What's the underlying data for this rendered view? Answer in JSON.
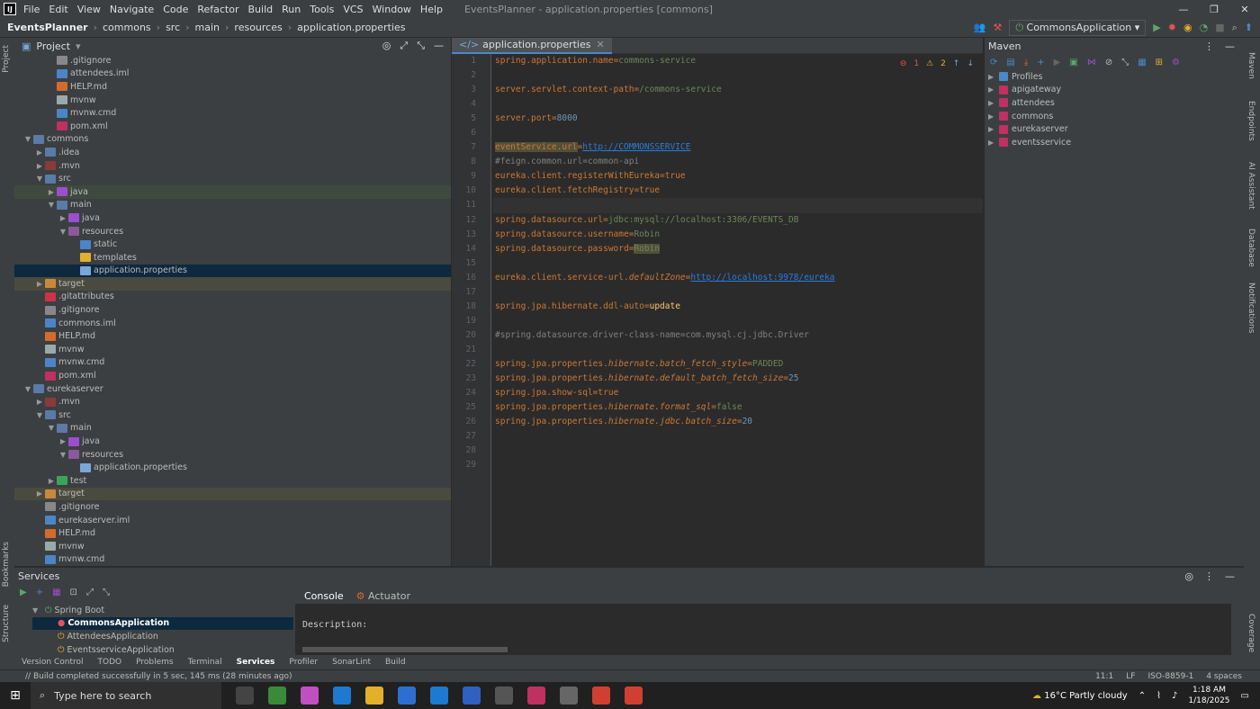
{
  "titlebar": {
    "menu": [
      "File",
      "Edit",
      "View",
      "Navigate",
      "Code",
      "Refactor",
      "Build",
      "Run",
      "Tools",
      "VCS",
      "Window",
      "Help"
    ],
    "title": "EventsPlanner - application.properties [commons]"
  },
  "navbar": {
    "crumbs": [
      "EventsPlanner",
      "commons",
      "src",
      "main",
      "resources",
      "application.properties"
    ],
    "run_config": "CommonsApplication"
  },
  "project": {
    "label": "Project",
    "rows": [
      {
        "d": 3,
        "a": "",
        "t": ".gitignore",
        "c": "#888",
        "s": ""
      },
      {
        "d": 3,
        "a": "",
        "t": "attendees.iml",
        "c": "#4a86c7",
        "s": ""
      },
      {
        "d": 3,
        "a": "",
        "t": "HELP.md",
        "c": "#d46b2d",
        "s": ""
      },
      {
        "d": 3,
        "a": "",
        "t": "mvnw",
        "c": "#9aa",
        "s": ""
      },
      {
        "d": 3,
        "a": "",
        "t": "mvnw.cmd",
        "c": "#4a86c7",
        "s": ""
      },
      {
        "d": 3,
        "a": "",
        "t": "pom.xml",
        "c": "#c03060",
        "s": ""
      },
      {
        "d": 1,
        "a": "▼",
        "t": "commons",
        "c": "#5a7ba8",
        "s": ""
      },
      {
        "d": 2,
        "a": "▶",
        "t": ".idea",
        "c": "#5a7ba8",
        "s": ""
      },
      {
        "d": 2,
        "a": "▶",
        "t": ".mvn",
        "c": "#8b3a3a",
        "s": ""
      },
      {
        "d": 2,
        "a": "▼",
        "t": "src",
        "c": "#5a7ba8",
        "s": ""
      },
      {
        "d": 3,
        "a": "▶",
        "t": "java",
        "c": "#9d4ed0",
        "s": "gr"
      },
      {
        "d": 3,
        "a": "▼",
        "t": "main",
        "c": "#5a7ba8",
        "s": ""
      },
      {
        "d": 4,
        "a": "▶",
        "t": "java",
        "c": "#9d4ed0",
        "s": ""
      },
      {
        "d": 4,
        "a": "▼",
        "t": "resources",
        "c": "#8a5a9a",
        "s": ""
      },
      {
        "d": 5,
        "a": "",
        "t": "static",
        "c": "#4a86c7",
        "s": ""
      },
      {
        "d": 5,
        "a": "",
        "t": "templates",
        "c": "#e2b02c",
        "s": ""
      },
      {
        "d": 5,
        "a": "",
        "t": "application.properties",
        "c": "#7aa7d9",
        "s": "sel"
      },
      {
        "d": 2,
        "a": "▶",
        "t": "target",
        "c": "#c88a3a",
        "s": "hl"
      },
      {
        "d": 2,
        "a": "",
        "t": ".gitattributes",
        "c": "#c34",
        "s": ""
      },
      {
        "d": 2,
        "a": "",
        "t": ".gitignore",
        "c": "#888",
        "s": ""
      },
      {
        "d": 2,
        "a": "",
        "t": "commons.iml",
        "c": "#4a86c7",
        "s": ""
      },
      {
        "d": 2,
        "a": "",
        "t": "HELP.md",
        "c": "#d46b2d",
        "s": ""
      },
      {
        "d": 2,
        "a": "",
        "t": "mvnw",
        "c": "#9aa",
        "s": ""
      },
      {
        "d": 2,
        "a": "",
        "t": "mvnw.cmd",
        "c": "#4a86c7",
        "s": ""
      },
      {
        "d": 2,
        "a": "",
        "t": "pom.xml",
        "c": "#c03060",
        "s": ""
      },
      {
        "d": 1,
        "a": "▼",
        "t": "eurekaserver",
        "c": "#5a7ba8",
        "s": ""
      },
      {
        "d": 2,
        "a": "▶",
        "t": ".mvn",
        "c": "#8b3a3a",
        "s": ""
      },
      {
        "d": 2,
        "a": "▼",
        "t": "src",
        "c": "#5a7ba8",
        "s": ""
      },
      {
        "d": 3,
        "a": "▼",
        "t": "main",
        "c": "#5a7ba8",
        "s": ""
      },
      {
        "d": 4,
        "a": "▶",
        "t": "java",
        "c": "#9d4ed0",
        "s": ""
      },
      {
        "d": 4,
        "a": "▼",
        "t": "resources",
        "c": "#8a5a9a",
        "s": ""
      },
      {
        "d": 5,
        "a": "",
        "t": "application.properties",
        "c": "#7aa7d9",
        "s": ""
      },
      {
        "d": 3,
        "a": "▶",
        "t": "test",
        "c": "#3aa55a",
        "s": ""
      },
      {
        "d": 2,
        "a": "▶",
        "t": "target",
        "c": "#c88a3a",
        "s": "hl"
      },
      {
        "d": 2,
        "a": "",
        "t": ".gitignore",
        "c": "#888",
        "s": ""
      },
      {
        "d": 2,
        "a": "",
        "t": "eurekaserver.iml",
        "c": "#4a86c7",
        "s": ""
      },
      {
        "d": 2,
        "a": "",
        "t": "HELP.md",
        "c": "#d46b2d",
        "s": ""
      },
      {
        "d": 2,
        "a": "",
        "t": "mvnw",
        "c": "#9aa",
        "s": ""
      },
      {
        "d": 2,
        "a": "",
        "t": "mvnw.cmd",
        "c": "#4a86c7",
        "s": ""
      }
    ]
  },
  "editor": {
    "tab": "application.properties",
    "errors": "1",
    "warnings": "2",
    "lines": [
      "<span class='k'>spring.application.name</span>=<span class='v'>commons-service</span>",
      "",
      "<span class='k'>server.servlet.context-path</span>=<span class='v'>/commons-service</span>",
      "",
      "<span class='k'>server.port</span>=<span class='num'>8000</span>",
      "",
      "<span class='k wb'>eventService.url</span>=<span class='lnk'>http://COMMONSSERVICE</span>",
      "<span class='cm'>#feign.common.url=common-api</span>",
      "<span class='k'>eureka.client.registerWithEureka</span>=<span class='k'>true</span>",
      "<span class='k'>eureka.client.fetchRegistry</span>=<span class='k'>true</span>",
      "",
      "<span class='k'>spring.datasource.url</span>=<span class='v'>jdbc:mysql://localhost:3306/EVENTS_DB</span>",
      "<span class='k'>spring.datasource.username</span>=<span class='v'>Robin</span>",
      "<span class='k'>spring.datasource.password</span>=<span class='v wb'>Robin</span>",
      "",
      "<span class='k'>eureka.client.service-url.</span><span class='k it'>defaultZone</span>=<span class='lnk'>http://localhost:9978/eureka</span>",
      "",
      "<span class='k'>spring.jpa.hibernate.ddl-auto</span>=<span class='ye'>update</span>",
      "",
      "<span class='cm'>#spring.datasource.driver-class-name=com.mysql.cj.jdbc.Driver</span>",
      "",
      "<span class='k'>spring.jpa.properties.</span><span class='k it'>hibernate.batch_fetch_style</span>=<span class='v'>PADDED</span>",
      "<span class='k'>spring.jpa.properties.</span><span class='k it'>hibernate.default_batch_fetch_size</span>=<span class='num'>25</span>",
      "<span class='k'>spring.jpa.show-sql</span>=<span class='k'>true</span>",
      "<span class='k'>spring.jpa.properties.</span><span class='k it'>hibernate.format_sql</span>=<span class='v'>false</span>",
      "<span class='k'>spring.jpa.properties.</span><span class='k it'>hibernate.jdbc.batch_size</span>=<span class='num'>20</span>",
      "",
      "",
      ""
    ]
  },
  "maven": {
    "label": "Maven",
    "items": [
      "Profiles",
      "apigateway",
      "attendees",
      "commons",
      "eurekaserver",
      "eventsservice"
    ]
  },
  "services": {
    "label": "Services",
    "group": "Spring Boot",
    "apps": [
      "CommonsApplication",
      "AttendeesApplication",
      "EventsserviceApplication"
    ],
    "tabs": [
      "Console",
      "Actuator"
    ],
    "console_text": "Description:"
  },
  "bottom_tabs": [
    "Version Control",
    "TODO",
    "Problems",
    "Terminal",
    "Services",
    "Profiler",
    "SonarLint",
    "Build"
  ],
  "status": {
    "message": "Build completed successfully in 5 sec, 145 ms (28 minutes ago)",
    "position": "11:1",
    "eol": "LF",
    "encoding": "ISO-8859-1",
    "indent": "4 spaces"
  },
  "left_strip": [
    "Project",
    "Bookmarks",
    "Structure"
  ],
  "right_strip": [
    "Maven",
    "Endpoints",
    "AI Assistant",
    "Database",
    "Notifications",
    "Coverage"
  ],
  "taskbar": {
    "search_placeholder": "Type here to search",
    "weather": "16°C  Partly cloudy",
    "time": "1:18 AM",
    "date": "1/18/2025"
  }
}
